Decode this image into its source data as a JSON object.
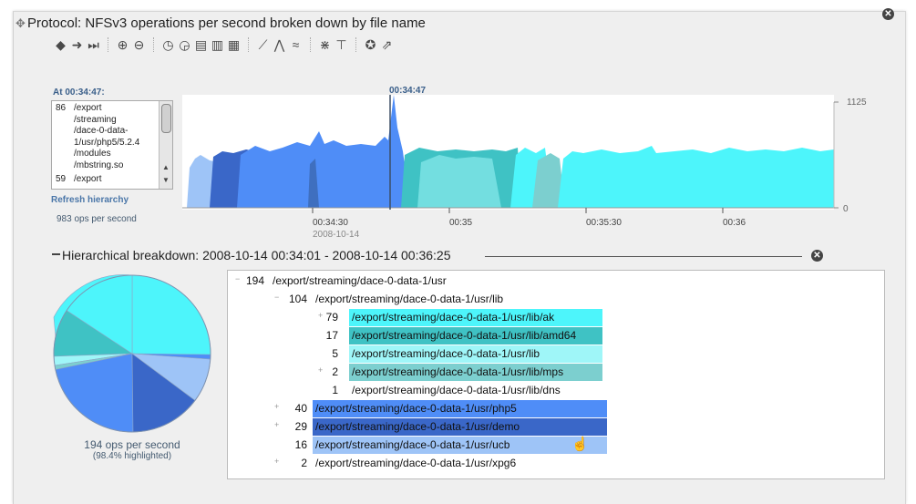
{
  "title": "Protocol: NFSv3 operations per second broken down by file name",
  "at_label": "At 00:34:47:",
  "list_rows": [
    {
      "count": "86",
      "text": "/export"
    },
    {
      "count": "",
      "text": "/streaming"
    },
    {
      "count": "",
      "text": "/dace-0-data-"
    },
    {
      "count": "",
      "text": "1/usr/php5/5.2.4"
    },
    {
      "count": "",
      "text": "/modules"
    },
    {
      "count": "",
      "text": "/mbstring.so"
    },
    {
      "count": "59",
      "text": "/export"
    }
  ],
  "refresh_label": "Refresh hierarchy",
  "ops_label": "983 ops per second",
  "cursor_time": "00:34:47",
  "y_max_label": "1125",
  "y_min_label": "0",
  "x_ticks": [
    "00:34:30",
    "00:35",
    "00:35:30",
    "00:36"
  ],
  "x_date": "2008-10-14",
  "hier_title": "Hierarchical breakdown: 2008-10-14 00:34:01 - 2008-10-14 00:36:25",
  "pie_ops": "194 ops per second",
  "pie_highlighted": "(98.4% highlighted)",
  "colors": {
    "cyan": "#4df5fb",
    "teal": "#3fc2c4",
    "light_cyan": "#9ff6f8",
    "teal_mid": "#7ccfcf",
    "blue": "#4f8df7",
    "dark_blue": "#3a67c8",
    "light_blue": "#9ec4f7"
  },
  "tree": [
    {
      "toggle": "−",
      "count": "194",
      "path": "/export/streaming/dace-0-data-1/usr",
      "level": 0,
      "color": ""
    },
    {
      "toggle": "−",
      "count": "104",
      "path": "/export/streaming/dace-0-data-1/usr/lib",
      "level": 1,
      "color": ""
    },
    {
      "toggle": "+",
      "count": "79",
      "path": "/export/streaming/dace-0-data-1/usr/lib/ak",
      "level": 2,
      "color": "#4df5fb"
    },
    {
      "toggle": "",
      "count": "17",
      "path": "/export/streaming/dace-0-data-1/usr/lib/amd64",
      "level": 2,
      "color": "#3fc2c4"
    },
    {
      "toggle": "",
      "count": "5",
      "path": "/export/streaming/dace-0-data-1/usr/lib",
      "level": 2,
      "color": "#9ff6f8"
    },
    {
      "toggle": "+",
      "count": "2",
      "path": "/export/streaming/dace-0-data-1/usr/lib/mps",
      "level": 2,
      "color": "#7ccfcf"
    },
    {
      "toggle": "",
      "count": "1",
      "path": "/export/streaming/dace-0-data-1/usr/lib/dns",
      "level": 2,
      "color": ""
    },
    {
      "toggle": "+",
      "count": "40",
      "path": "/export/streaming/dace-0-data-1/usr/php5",
      "level": 1,
      "color": "#4f8df7"
    },
    {
      "toggle": "+",
      "count": "29",
      "path": "/export/streaming/dace-0-data-1/usr/demo",
      "level": 1,
      "color": "#3a67c8"
    },
    {
      "toggle": "",
      "count": "16",
      "path": "/export/streaming/dace-0-data-1/usr/ucb",
      "level": 1,
      "color": "#9ec4f7"
    },
    {
      "toggle": "+",
      "count": "2",
      "path": "/export/streaming/dace-0-data-1/usr/xpg6",
      "level": 1,
      "color": ""
    }
  ],
  "toolbar_icons": [
    "back-arrow-icon",
    "forward-arrow-icon",
    "skip-end-icon",
    "zoom-in-icon",
    "zoom-out-icon",
    "clock-back-icon",
    "clock-forward-icon",
    "table-icon",
    "table-alt-icon",
    "grid-icon",
    "line-chart-icon",
    "stacked-chart-icon",
    "area-chart-icon",
    "merge-icon",
    "hierarchy-icon",
    "palette-icon",
    "popout-icon"
  ]
}
